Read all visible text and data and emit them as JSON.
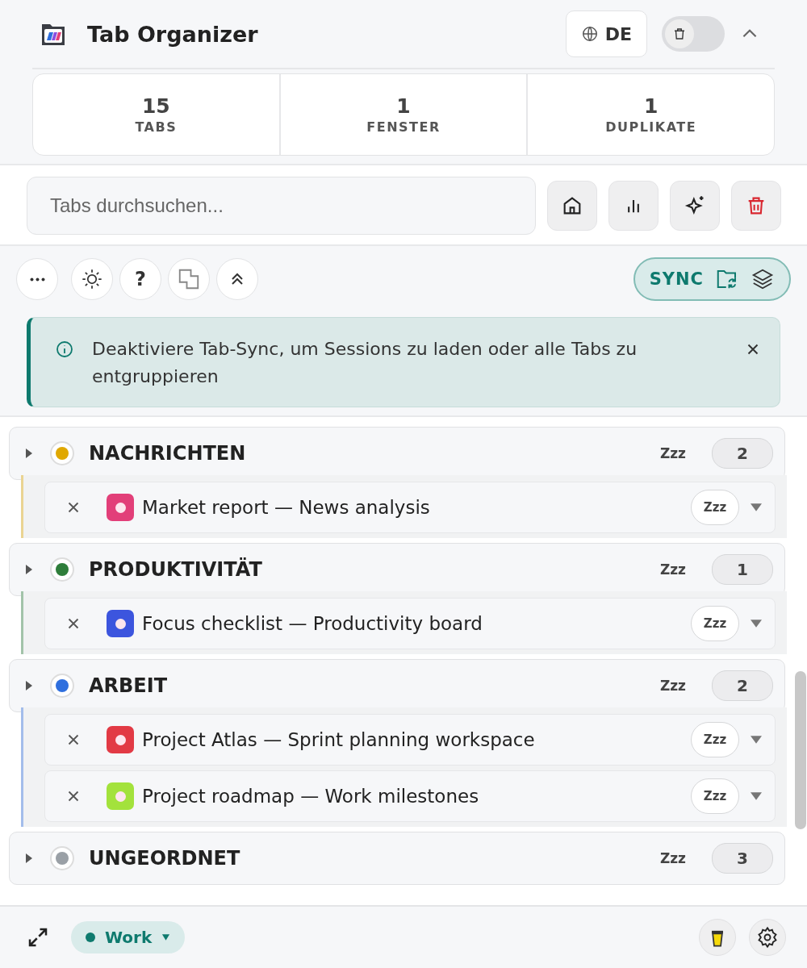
{
  "header": {
    "title": "Tab Organizer",
    "language": "DE",
    "trash_toggle": {
      "on": false
    }
  },
  "stats": [
    {
      "value": "15",
      "label": "TABS"
    },
    {
      "value": "1",
      "label": "FENSTER"
    },
    {
      "value": "1",
      "label": "DUPLIKATE"
    }
  ],
  "search": {
    "placeholder": "Tabs durchsuchen..."
  },
  "toolbar": {
    "help_label": "?",
    "sync": {
      "label": "SYNC",
      "on": true
    }
  },
  "banner": {
    "text": "Deaktiviere Tab-Sync, um Sessions zu laden oder alle Tabs zu entgruppieren"
  },
  "groups": [
    {
      "name": "NACHRICHTEN",
      "color": "#e0a800",
      "sleep_label": "Zzz",
      "count": "2",
      "tabs": [
        {
          "title": "Market report — News analysis",
          "color": "#e23f79",
          "sleep_label": "Zzz"
        }
      ]
    },
    {
      "name": "PRODUKTIVITÄT",
      "color": "#2e7d3a",
      "sleep_label": "Zzz",
      "count": "1",
      "tabs": [
        {
          "title": "Focus checklist — Productivity board",
          "color": "#3c55de",
          "sleep_label": "Zzz"
        }
      ]
    },
    {
      "name": "ARBEIT",
      "color": "#2f6fde",
      "sleep_label": "Zzz",
      "count": "2",
      "tabs": [
        {
          "title": "Project Atlas — Sprint planning workspace",
          "color": "#e23a45",
          "sleep_label": "Zzz"
        },
        {
          "title": "Project roadmap — Work milestones",
          "color": "#a3e23c",
          "sleep_label": "Zzz"
        }
      ]
    },
    {
      "name": "UNGEORDNET",
      "color": "#9aa0a6",
      "sleep_label": "Zzz",
      "count": "3"
    }
  ],
  "footer": {
    "workspace": {
      "label": "Work",
      "color": "#0e7a6e"
    }
  }
}
